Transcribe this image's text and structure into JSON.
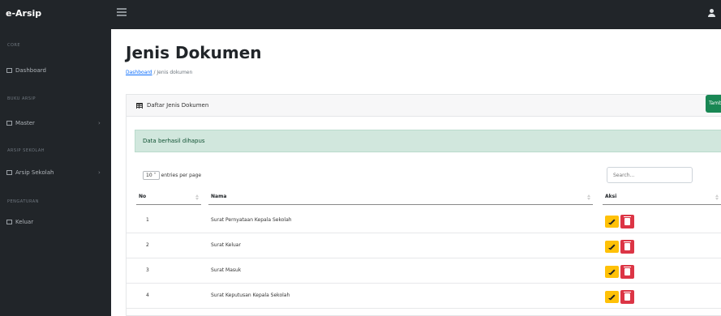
{
  "topbar": {
    "brand": "e-Arsip"
  },
  "sidebar": {
    "headings": [
      "CORE",
      "BUKU ARSIP",
      "ARSIP SEKOLAH",
      "PENGATURAN"
    ],
    "items": [
      {
        "label": "Dashboard",
        "icon": "dashboard-icon"
      },
      {
        "label": "Master",
        "icon": "folder-icon"
      },
      {
        "label": "Arsip Sekolah",
        "icon": "archive-icon"
      },
      {
        "label": "Keluar",
        "icon": "logout-icon"
      }
    ]
  },
  "page": {
    "title": "Jenis Dokumen",
    "breadcrumb": {
      "link": "Dashboard",
      "current": "/ Jenis dokumen"
    }
  },
  "card": {
    "title": "Daftar Jenis Dokumen",
    "add_button": "Tambah"
  },
  "alert": {
    "message": "Data berhasil dihapus"
  },
  "table": {
    "entries_value": "10",
    "entries_suffix": "entries per page",
    "search_placeholder": "Search...",
    "columns": [
      "No",
      "Nama",
      "Aksi"
    ],
    "rows": [
      {
        "no": "1",
        "nama": "Surat Pernyataan Kepala Sekolah"
      },
      {
        "no": "2",
        "nama": "Surat Keluar"
      },
      {
        "no": "3",
        "nama": "Surat Masuk"
      },
      {
        "no": "4",
        "nama": "Surat Keputusan Kepala Sekolah"
      }
    ]
  },
  "colors": {
    "topbar": "#212529",
    "success": "#198754",
    "alert_bg": "#d1e7dd",
    "edit": "#ffc107",
    "delete": "#dc3545",
    "link": "#0d6efd"
  }
}
